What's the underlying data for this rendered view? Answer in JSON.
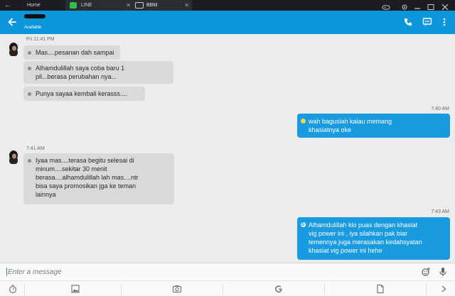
{
  "tabs": [
    {
      "label": "Home"
    },
    {
      "label": "LINE"
    },
    {
      "label": "BBM"
    }
  ],
  "header": {
    "contact_status": "Available"
  },
  "messages": {
    "ts1": "Fri 11:41 PM",
    "m1": "Mas....pesanan dah sampai",
    "m2_l1": "Alhamdulillah saya coba baru 1",
    "m2_l2": "pil...berasa perubahan nya...",
    "m3": "Punya sayaa kembali kerasss....",
    "ts2": "7:40 AM",
    "o1_l1": "wah baguslah kalau memang",
    "o1_l2": "khasiatnya oke",
    "ts3": "7:41 AM",
    "m4_l1": "Iyaa mas....terasa begitu selesai di",
    "m4_l2": "minum....sekitar 30 menit",
    "m4_l3": "berasa....alhamdulillah lah mas....ntr",
    "m4_l4": "bisa saya promosikan jga ke teman",
    "m4_l5": "lainnya",
    "ts4": "7:43 AM",
    "o2_l1": "Alhamdulillah klo puas dengan khasiat",
    "o2_l2": "vig power ini , iya silahkan pak biar",
    "o2_l3": "temennya juga merasakan kedahsyatan",
    "o2_l4": "khasiat vig power ini hehe"
  },
  "composer": {
    "placeholder": "Enter a message"
  },
  "colors": {
    "header": "#0d96da",
    "outgoing_bubble": "#1a9be0",
    "incoming_bubble": "#d9d9d9",
    "background": "#ececec"
  },
  "icons": {
    "header": [
      "back-arrow-icon",
      "phone-icon",
      "chat-options-icon",
      "more-vert-icon"
    ],
    "composer": [
      "emoji-icon",
      "microphone-icon"
    ],
    "toolbar": [
      "timer-icon",
      "image-icon",
      "camera-icon",
      "google-icon",
      "file-icon",
      "chevron-right-icon"
    ]
  }
}
